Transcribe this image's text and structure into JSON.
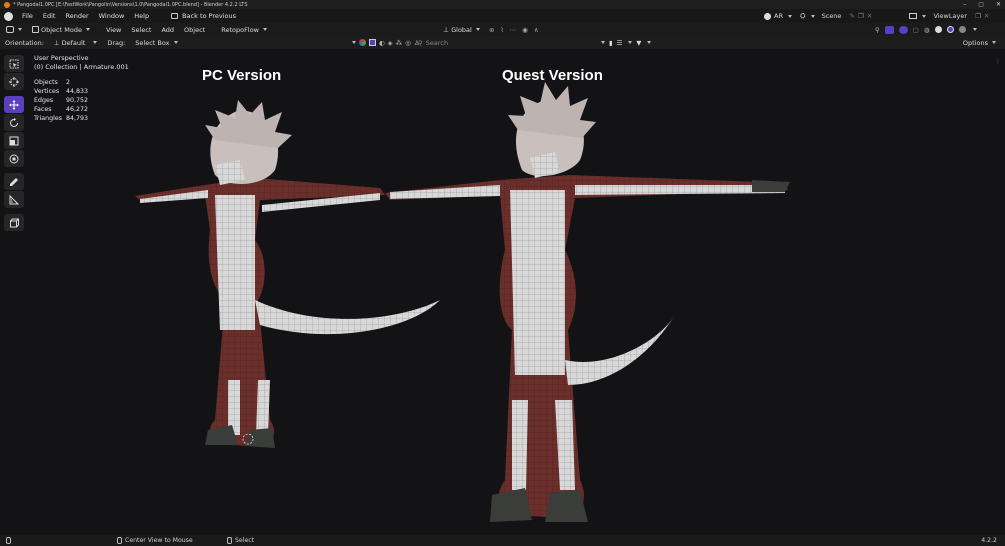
{
  "window": {
    "title": "* Pangodal1.0PC [E:\\FastWork\\Pangolin\\Versions\\1.0\\Pangodal1.0PC.blend] - Blender 4.2.2 LTS",
    "controls": [
      "–",
      "▢",
      "✕"
    ]
  },
  "menubar": {
    "items": [
      "File",
      "Edit",
      "Render",
      "Window",
      "Help"
    ],
    "back_to_previous": "Back to Previous",
    "workspace_ar": "AR",
    "scene": "Scene",
    "view_layer": "ViewLayer"
  },
  "header": {
    "editor_type_icon": "view3d-icon",
    "mode": "Object Mode",
    "menus": [
      "View",
      "Select",
      "Add",
      "Object"
    ],
    "addon": "RetopoFlow",
    "transform_orientation": "Global",
    "options": "Options"
  },
  "toolsettings": {
    "orientation_label": "Orientation:",
    "orientation_value": "Default",
    "drag_label": "Drag:",
    "drag_value": "Select Box",
    "search_placeholder": "Search"
  },
  "viewport": {
    "view_name": "User Perspective",
    "collection_line": "(0) Collection | Armature.001",
    "stats": [
      {
        "label": "Objects",
        "value": "2"
      },
      {
        "label": "Vertices",
        "value": "44,833"
      },
      {
        "label": "Edges",
        "value": "90,752"
      },
      {
        "label": "Faces",
        "value": "46,272"
      },
      {
        "label": "Triangles",
        "value": "84,793"
      }
    ],
    "captions": {
      "left": "PC Version",
      "right": "Quest Version"
    }
  },
  "toolbar": {
    "tools": [
      "select-box",
      "cursor",
      "move",
      "rotate",
      "scale",
      "transform",
      "annotate",
      "measure",
      "add-cube"
    ],
    "active_tool": "move"
  },
  "statusbar": {
    "hint_1": "Center View to Mouse",
    "hint_2": "Select",
    "version": "4.2.2"
  },
  "colors": {
    "accent": "#5a3fc0",
    "body_maroon": "#5e2a26",
    "mesh_white": "#cfcfcf"
  }
}
